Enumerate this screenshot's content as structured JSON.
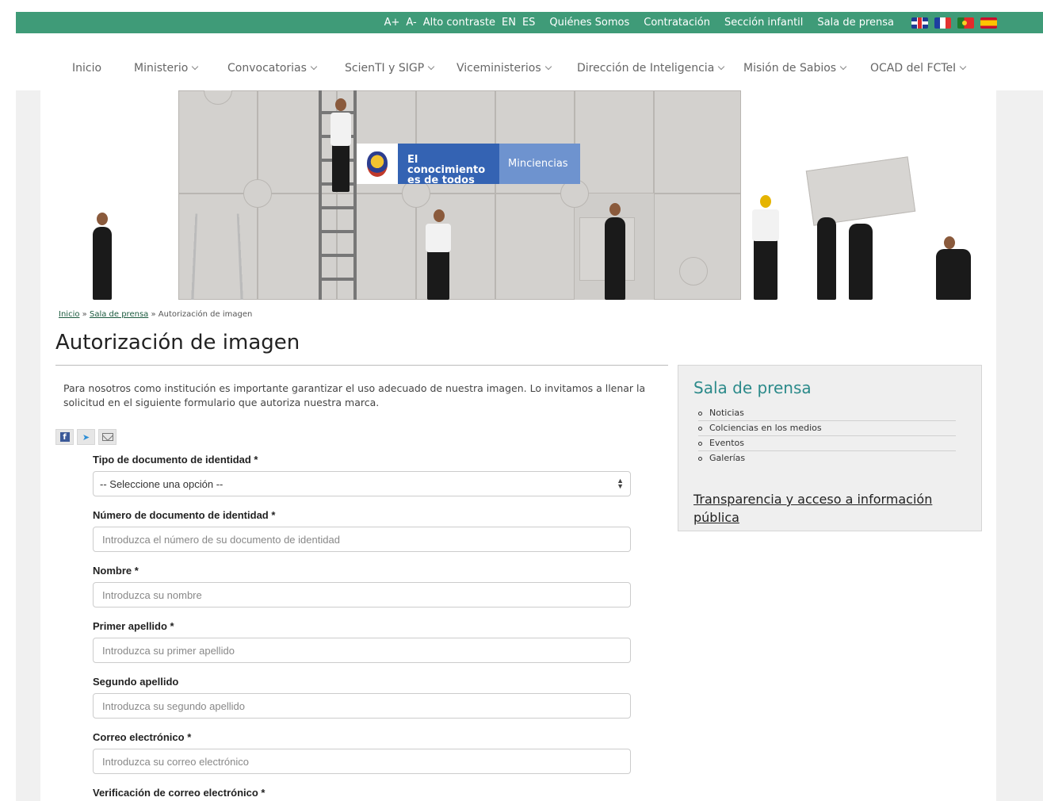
{
  "topbar": {
    "links": [
      "A+",
      "A-",
      "Alto contraste",
      "EN",
      "ES",
      "Quiénes Somos",
      "Contratación",
      "Sección infantil",
      "Sala de prensa"
    ],
    "flags": [
      "uk-flag-icon",
      "france-flag-icon",
      "portugal-flag-icon",
      "spain-flag-icon"
    ],
    "background": "#3f9b78"
  },
  "nav": {
    "items": [
      "Inicio",
      "Ministerio",
      "Convocatorias",
      "ScienTI y SIGP",
      "Viceministerios",
      "Dirección de Inteligencia",
      "Misión de Sabios",
      "OCAD del FCTeI"
    ]
  },
  "banner": {
    "logo_line1": "El conocimiento",
    "logo_line2": "es de todos",
    "logo_brand": "Minciencias"
  },
  "breadcrumb": {
    "home": "Inicio",
    "sep": "»",
    "section": "Sala de prensa",
    "current": "Autorización de imagen"
  },
  "page": {
    "title": "Autorización de imagen",
    "intro": "Para nosotros como institución es importante garantizar el uso adecuado de nuestra imagen. Lo invitamos a llenar la solicitud en el siguiente formulario que autoriza nuestra marca."
  },
  "share": {
    "facebook": "f",
    "twitter": "t"
  },
  "form": {
    "doc_type_label": "Tipo de documento de identidad *",
    "doc_type_value": "-- Seleccione una opción --",
    "doc_number_label": "Número de documento de identidad *",
    "doc_number_placeholder": "Introduzca el número de su documento de identidad",
    "name_label": "Nombre *",
    "name_placeholder": "Introduzca su nombre",
    "last1_label": "Primer apellido *",
    "last1_placeholder": "Introduzca su primer apellido",
    "last2_label": "Segundo apellido",
    "last2_placeholder": "Introduzca su segundo apellido",
    "email_label": "Correo electrónico *",
    "email_placeholder": "Introduzca su correo electrónico",
    "email_verify_label": "Verificación de correo electrónico *"
  },
  "sidebar": {
    "title": "Sala de prensa",
    "items": [
      "Noticias",
      "Colciencias en los medios",
      "Eventos",
      "Galerías"
    ],
    "link": "Transparencia y acceso a información pública",
    "title_color": "#2b8a8a"
  }
}
